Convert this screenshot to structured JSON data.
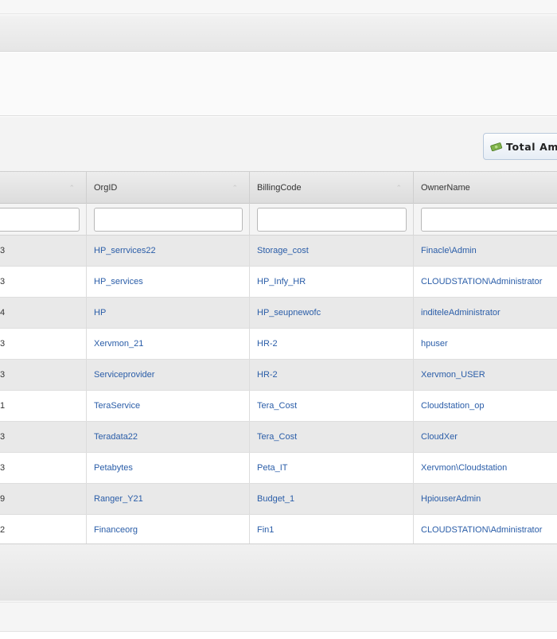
{
  "toolbar": {
    "total_button_label": "Total Am",
    "total_button_icon": "money-icon"
  },
  "grid": {
    "columns": [
      {
        "label": "",
        "sortable": true
      },
      {
        "label": "OrgID",
        "sortable": true
      },
      {
        "label": "BillingCode",
        "sortable": true
      },
      {
        "label": "OwnerName",
        "sortable": false
      }
    ],
    "filters": [
      "",
      "",
      "",
      ""
    ],
    "rows": [
      {
        "col0": "3",
        "org_id": "HP_serrvices22",
        "billing_code": "Storage_cost",
        "owner_name": "Finacle\\Admin"
      },
      {
        "col0": "3",
        "org_id": "HP_services",
        "billing_code": "HP_Infy_HR",
        "owner_name": "CLOUDSTATION\\Administrator"
      },
      {
        "col0": "4",
        "org_id": "HP",
        "billing_code": "HP_seupnewofc",
        "owner_name": "inditeleAdministrator"
      },
      {
        "col0": "3",
        "org_id": "Xervmon_21",
        "billing_code": "HR-2",
        "owner_name": "hpuser"
      },
      {
        "col0": "3",
        "org_id": "Serviceprovider",
        "billing_code": "HR-2",
        "owner_name": "Xervmon_USER"
      },
      {
        "col0": "1",
        "org_id": "TeraService",
        "billing_code": "Tera_Cost",
        "owner_name": "Cloudstation_op"
      },
      {
        "col0": "3",
        "org_id": "Teradata22",
        "billing_code": "Tera_Cost",
        "owner_name": "CloudXer"
      },
      {
        "col0": "3",
        "org_id": "Petabytes",
        "billing_code": "Peta_IT",
        "owner_name": "Xervmon\\Cloudstation"
      },
      {
        "col0": "9",
        "org_id": "Ranger_Y21",
        "billing_code": "Budget_1",
        "owner_name": "HpiouserAdmin"
      },
      {
        "col0": "2",
        "org_id": "Financeorg",
        "billing_code": "Fin1",
        "owner_name": "CLOUDSTATION\\Administrator"
      }
    ]
  },
  "colors": {
    "link": "#2a5da8",
    "row_alt": "#e9e9e9",
    "header_bg": "#e4e4e4"
  }
}
